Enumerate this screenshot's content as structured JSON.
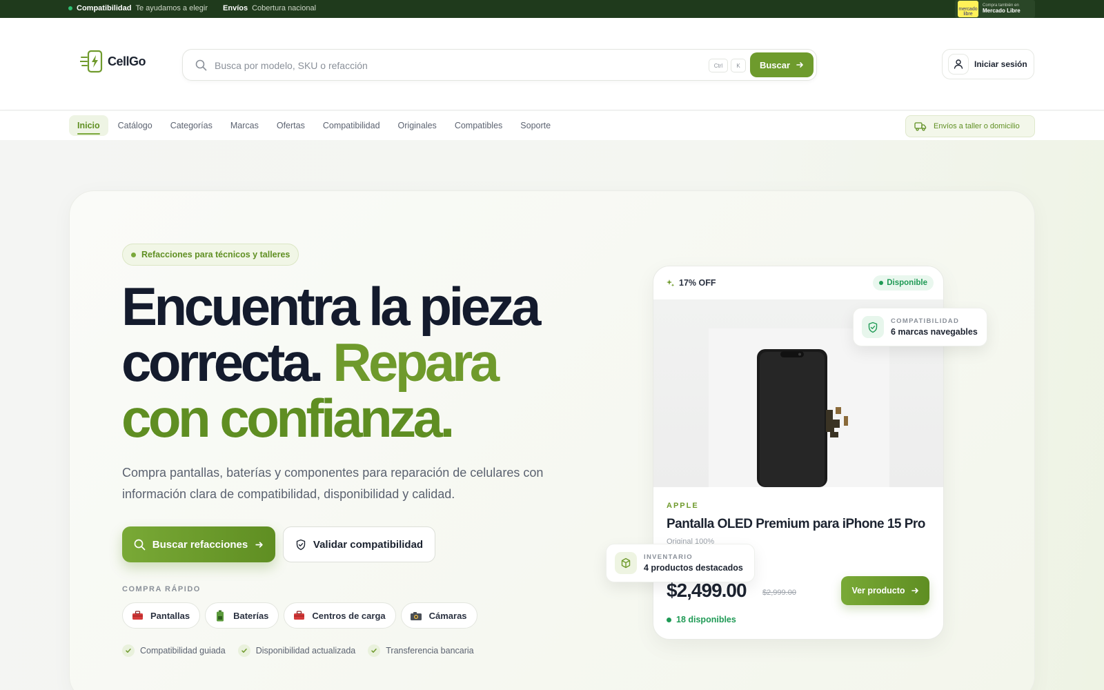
{
  "topbar": {
    "compat_title": "Compatibilidad",
    "compat_text": "Te ayudamos a elegir",
    "ship_title": "Envíos",
    "ship_text": "Cobertura nacional",
    "social": [
      "whatsapp-icon",
      "facebook-icon"
    ],
    "ml_small": "Compra también en",
    "ml_big": "Mercado Libre",
    "ml_logo": "mercado libre"
  },
  "header": {
    "logo_text": "CellGo",
    "search_placeholder": "Busca por modelo, SKU o refacción",
    "kbd_ctrl": "Ctrl",
    "kbd_k": "K",
    "search_button": "Buscar",
    "login": "Iniciar sesión"
  },
  "nav": {
    "items": [
      {
        "label": "Inicio",
        "active": true
      },
      {
        "label": "Catálogo"
      },
      {
        "label": "Categorías"
      },
      {
        "label": "Marcas"
      },
      {
        "label": "Ofertas"
      },
      {
        "label": "Compatibilidad"
      },
      {
        "label": "Originales"
      },
      {
        "label": "Compatibles"
      },
      {
        "label": "Soporte"
      }
    ],
    "shipping_badge": "Envíos a taller o domicilio"
  },
  "hero": {
    "pill": "Refacciones para técnicos y talleres",
    "headline_dark_1": "Encuentra la pieza",
    "headline_dark_2": "correcta.",
    "headline_green_1": "Repara",
    "headline_green_2": "con confianza.",
    "subtitle": "Compra pantallas, baterías y componentes para reparación de celulares con información clara de compatibilidad, disponibilidad y calidad.",
    "primary_button": "Buscar refacciones",
    "secondary_button": "Validar compatibilidad",
    "quick_label": "COMPRA RÁPIDO",
    "quick_chips": [
      {
        "label": "Pantallas",
        "icon": "toolbox-icon"
      },
      {
        "label": "Baterías",
        "icon": "battery-icon"
      },
      {
        "label": "Centros de carga",
        "icon": "toolbox-icon"
      },
      {
        "label": "Cámaras",
        "icon": "camera-icon"
      }
    ],
    "checks": [
      "Compatibilidad guiada",
      "Disponibilidad actualizada",
      "Transferencia bancaria"
    ]
  },
  "product": {
    "discount": "17% OFF",
    "availability": "Disponible",
    "brand": "APPLE",
    "name": "Pantalla OLED Premium para iPhone 15 Pro",
    "quality": "Original 100%",
    "price": "$2,499.00",
    "old_price": "$2,999.00",
    "button": "Ver producto",
    "stock": "18 disponibles"
  },
  "floats": {
    "compat_label": "COMPATIBILIDAD",
    "compat_value": "6 marcas navegables",
    "inv_label": "INVENTARIO",
    "inv_value": "4 productos destacados"
  },
  "colors": {
    "brand_green": "#6f9a2c",
    "dark_green_bar": "#1f3a1c",
    "status_green": "#1f9a55",
    "ink": "#141b2d"
  }
}
